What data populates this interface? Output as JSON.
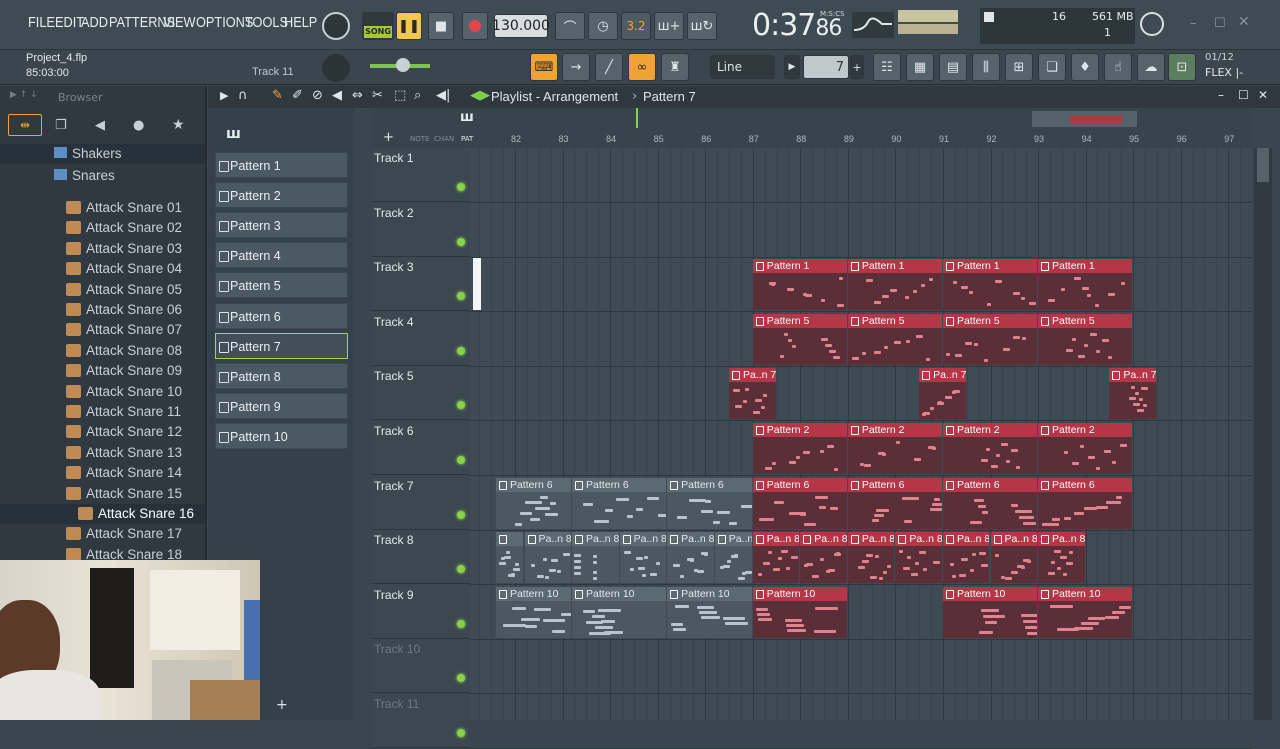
{
  "menu": [
    "FILE",
    "EDIT",
    "ADD",
    "PATTERNS",
    "VIEW",
    "OPTIONS",
    "TOOLS",
    "HELP"
  ],
  "transport": {
    "mode": "SONG",
    "tempo": "130.000",
    "time": "0:37",
    "time_sub": "86",
    "time_label": "M:S:CS",
    "snap": "Line",
    "pattern_num": "7",
    "cpu": "16",
    "ram": "561 MB",
    "voices": "1",
    "step_label": "3.2"
  },
  "project": {
    "name": "Project_4.flp",
    "position": "85:03:00",
    "hint": "Track 11"
  },
  "plugin": {
    "page": "01/12",
    "name": "FLEX |-"
  },
  "browser": {
    "title": "Browser",
    "folders": [
      "Shakers",
      "Snares"
    ],
    "files": [
      "Attack Snare 01",
      "Attack Snare 02",
      "Attack Snare 03",
      "Attack Snare 04",
      "Attack Snare 05",
      "Attack Snare 06",
      "Attack Snare 07",
      "Attack Snare 08",
      "Attack Snare 09",
      "Attack Snare 10",
      "Attack Snare 11",
      "Attack Snare 12",
      "Attack Snare 13",
      "Attack Snare 14",
      "Attack Snare 15",
      "Attack Snare 16",
      "Attack Snare 17",
      "Attack Snare 18"
    ],
    "selected": "Attack Snare 16"
  },
  "playlist": {
    "title": "Playlist - Arrangement",
    "pattern": "Pattern 7",
    "col_labels": [
      "NOTE",
      "CHAN",
      "PAT"
    ],
    "bars": [
      "82",
      "83",
      "84",
      "85",
      "86",
      "87",
      "88",
      "89",
      "90",
      "91",
      "92",
      "93",
      "94",
      "95",
      "96",
      "97"
    ]
  },
  "patterns": [
    "Pattern 1",
    "Pattern 2",
    "Pattern 3",
    "Pattern 4",
    "Pattern 5",
    "Pattern 6",
    "Pattern 7",
    "Pattern 8",
    "Pattern 9",
    "Pattern 10"
  ],
  "selected_pattern": "Pattern 7",
  "tracks": [
    "Track 1",
    "Track 2",
    "Track 3",
    "Track 4",
    "Track 5",
    "Track 6",
    "Track 7",
    "Track 8",
    "Track 9",
    "Track 10",
    "Track 11"
  ],
  "clips": [
    {
      "track": 3,
      "label": "Pattern 1"
    },
    {
      "track": 3,
      "label": "Pattern 1"
    },
    {
      "track": 3,
      "label": "Pattern 1"
    },
    {
      "track": 3,
      "label": "Pattern 1"
    },
    {
      "track": 4,
      "label": "Pattern 5"
    },
    {
      "track": 4,
      "label": "Pattern 5"
    },
    {
      "track": 4,
      "label": "Pattern 5"
    },
    {
      "track": 4,
      "label": "Pattern 5"
    },
    {
      "track": 5,
      "label": "Pa..n 7"
    },
    {
      "track": 5,
      "label": "Pa..n 7"
    },
    {
      "track": 5,
      "label": "Pa..n 7"
    },
    {
      "track": 6,
      "label": "Pattern 2"
    },
    {
      "track": 6,
      "label": "Pattern 2"
    },
    {
      "track": 6,
      "label": "Pattern 2"
    },
    {
      "track": 6,
      "label": "Pattern 2"
    },
    {
      "track": 7,
      "label": "Pattern 6"
    },
    {
      "track": 7,
      "label": "Pattern 6"
    },
    {
      "track": 7,
      "label": "Pattern 6"
    },
    {
      "track": 7,
      "label": "Pattern 6"
    },
    {
      "track": 7,
      "label": "Pattern 6"
    },
    {
      "track": 7,
      "label": "Pattern 6"
    },
    {
      "track": 7,
      "label": "Pattern 6"
    },
    {
      "track": 8,
      "label": ""
    },
    {
      "track": 8,
      "label": "Pa..n 8"
    },
    {
      "track": 8,
      "label": "Pa..n 8"
    },
    {
      "track": 8,
      "label": "Pa..n 8"
    },
    {
      "track": 8,
      "label": "Pa..n 8"
    },
    {
      "track": 8,
      "label": "Pa..n 8"
    },
    {
      "track": 8,
      "label": "Pa..n 8"
    },
    {
      "track": 8,
      "label": "Pa..n 8"
    },
    {
      "track": 8,
      "label": "Pa..n 8"
    },
    {
      "track": 8,
      "label": "Pa..n 8"
    },
    {
      "track": 8,
      "label": "Pa..n 8"
    },
    {
      "track": 8,
      "label": "Pa..n 8"
    },
    {
      "track": 8,
      "label": "Pa..n 8"
    },
    {
      "track": 9,
      "label": "Pattern 10"
    },
    {
      "track": 9,
      "label": "Pattern 10"
    },
    {
      "track": 9,
      "label": "Pattern 10"
    },
    {
      "track": 9,
      "label": "Pattern 10"
    },
    {
      "track": 9,
      "label": "Pattern 10"
    },
    {
      "track": 9,
      "label": "Pattern 10"
    }
  ]
}
